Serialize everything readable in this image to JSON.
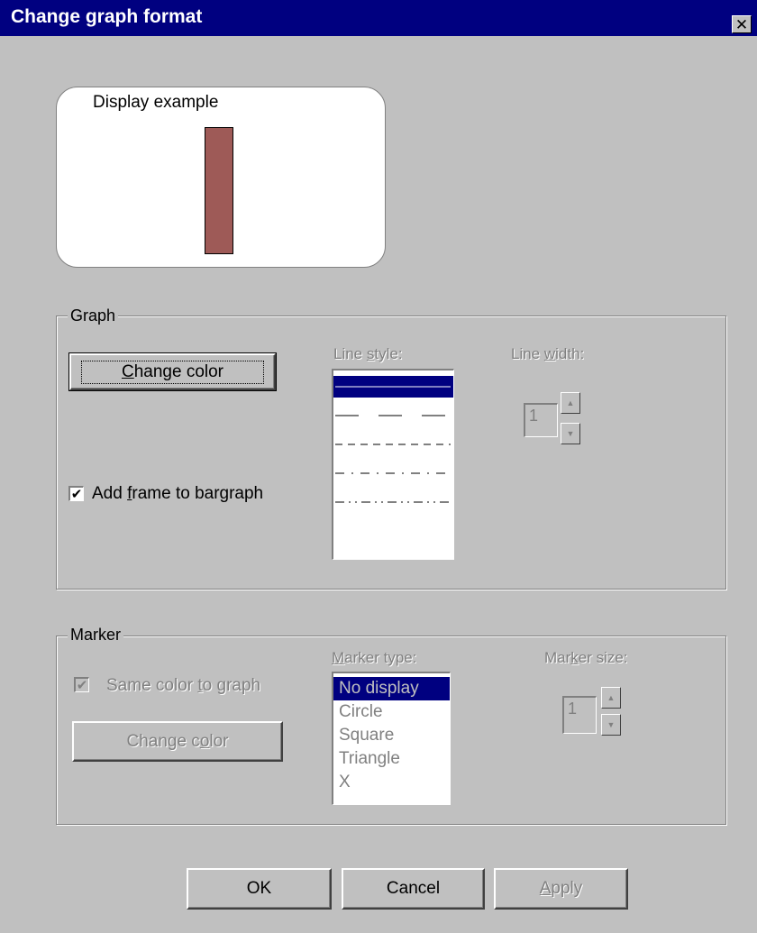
{
  "window": {
    "title": "Change graph format",
    "close_glyph": "✕"
  },
  "preview": {
    "label": "Display example",
    "bar_color": "#9e5a57"
  },
  "graph": {
    "legend": "Graph",
    "change_color_label": "Change color",
    "add_frame_label": "Add frame to bargraph",
    "add_frame_checked": true,
    "line_style_label": "Line style:",
    "line_styles": [
      "solid",
      "long-dash",
      "dash",
      "dash-dot",
      "dash-dot-dot"
    ],
    "line_style_selected": 0,
    "line_width_label": "Line width:",
    "line_width_value": "1"
  },
  "marker": {
    "legend": "Marker",
    "same_color_label": "Same color to graph",
    "same_color_checked": true,
    "change_color_label": "Change color",
    "marker_type_label": "Marker type:",
    "marker_types": [
      "No display",
      "Circle",
      "Square",
      "Triangle",
      "X"
    ],
    "marker_type_selected": 0,
    "marker_size_label": "Marker size:",
    "marker_size_value": "1"
  },
  "buttons": {
    "ok": "OK",
    "cancel": "Cancel",
    "apply": "Apply"
  },
  "icons": {
    "check": "check-icon",
    "up": "spin-up-icon",
    "down": "spin-down-icon",
    "close": "close-icon"
  },
  "colors": {
    "selection": "#000080",
    "dialog": "#c0c0c0"
  }
}
